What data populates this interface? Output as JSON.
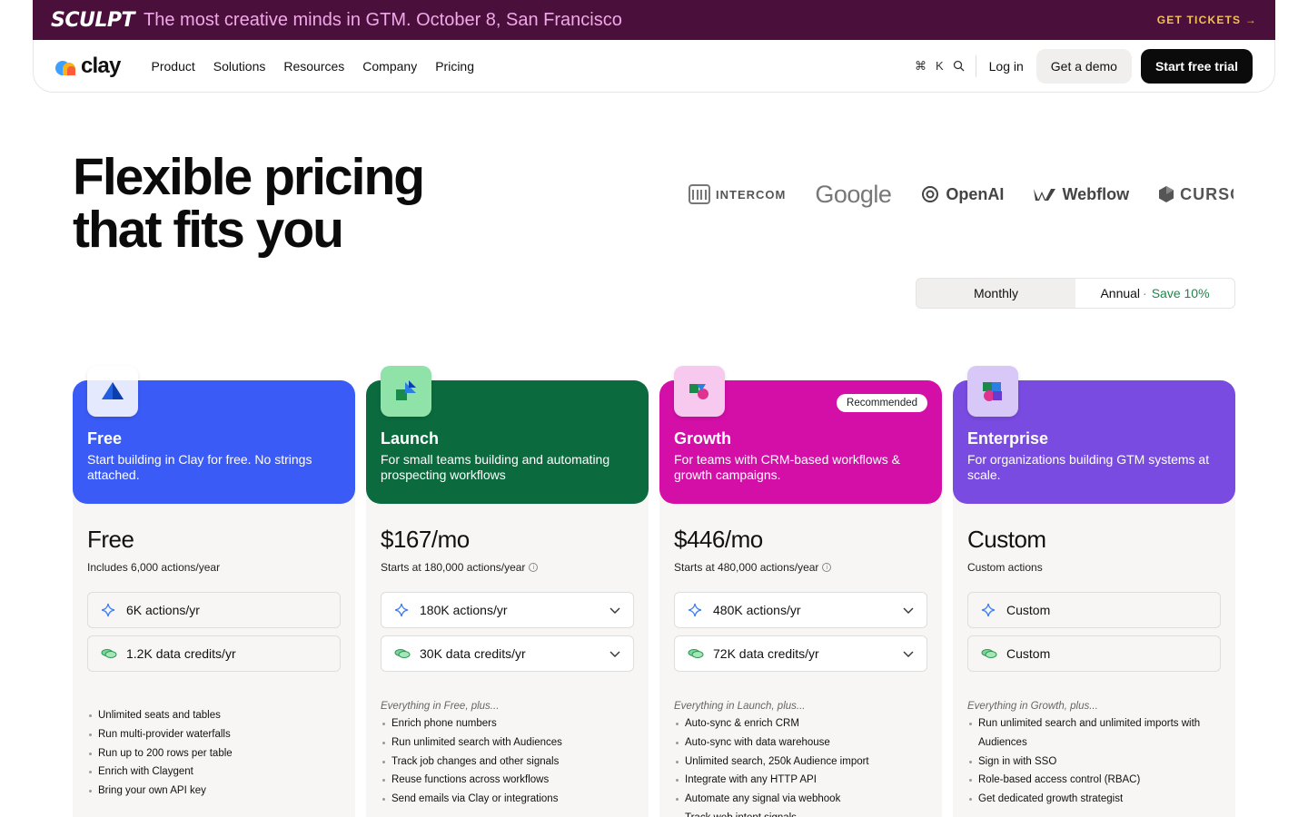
{
  "banner": {
    "logo": "SCULPT",
    "text": "The most creative minds in GTM. October 8, San Francisco",
    "cta": "GET TICKETS →"
  },
  "nav": {
    "brand": "clay",
    "links": [
      "Product",
      "Solutions",
      "Resources",
      "Company",
      "Pricing"
    ],
    "shortcut_cmd": "⌘",
    "shortcut_key": "K",
    "login": "Log in",
    "demo": "Get a demo",
    "trial": "Start free trial"
  },
  "hero": {
    "title_line1": "Flexible pricing",
    "title_line2": "that fits you"
  },
  "logos": {
    "intercom": "INTERCOM",
    "google": "Google",
    "openai": "OpenAI",
    "webflow": "Webflow",
    "cursor": "CURSOR"
  },
  "billing": {
    "monthly": "Monthly",
    "annual": "Annual",
    "separator": "·",
    "save": "Save 10%",
    "selected": "Monthly"
  },
  "plans": [
    {
      "name": "Free",
      "description": "Start building in Clay for free. No strings attached.",
      "price": "Free",
      "subtext": "Includes 6,000 actions/year",
      "actions": "6K actions/yr",
      "credits": "1.2K data credits/yr",
      "features": [
        "Unlimited seats and tables",
        "Run multi-provider waterfalls",
        "Run up to 200 rows per table",
        "Enrich with Claygent",
        "Bring your own API key"
      ]
    },
    {
      "name": "Launch",
      "description": "For small teams building and automating prospecting workflows",
      "price": "$167/mo",
      "subtext": "Starts at 180,000 actions/year",
      "actions": "180K actions/yr",
      "credits": "30K data credits/yr",
      "features_intro": "Everything in Free, plus...",
      "features": [
        "Enrich phone numbers",
        "Run unlimited search with Audiences",
        "Track job changes and other signals",
        "Reuse functions across workflows",
        "Send emails via Clay or integrations"
      ]
    },
    {
      "name": "Growth",
      "badge": "Recommended",
      "description": "For teams with CRM-based workflows & growth campaigns.",
      "price": "$446/mo",
      "subtext": "Starts at 480,000 actions/year",
      "actions": "480K actions/yr",
      "credits": "72K data credits/yr",
      "features_intro": "Everything in Launch, plus...",
      "features": [
        "Auto-sync & enrich CRM",
        "Auto-sync with data warehouse",
        "Unlimited search, 250k Audience import",
        "Integrate with any HTTP API",
        "Automate any signal via webhook",
        "Track web intent signals"
      ]
    },
    {
      "name": "Enterprise",
      "description": "For organizations building GTM systems at scale.",
      "price": "Custom",
      "subtext": "Custom actions",
      "actions": "Custom",
      "credits": "Custom",
      "features_intro": "Everything in Growth, plus...",
      "features": [
        "Run unlimited search and unlimited imports with Audiences",
        "Sign in with SSO",
        "Role-based access control (RBAC)",
        "Get dedicated growth strategist"
      ]
    }
  ],
  "colors": {
    "banner_bg": "#4a0f3a",
    "free": "#3b5bf6",
    "launch": "#0b6b3e",
    "growth": "#d40fa8",
    "enterprise": "#7a4be0",
    "save": "#1a8a4a"
  }
}
